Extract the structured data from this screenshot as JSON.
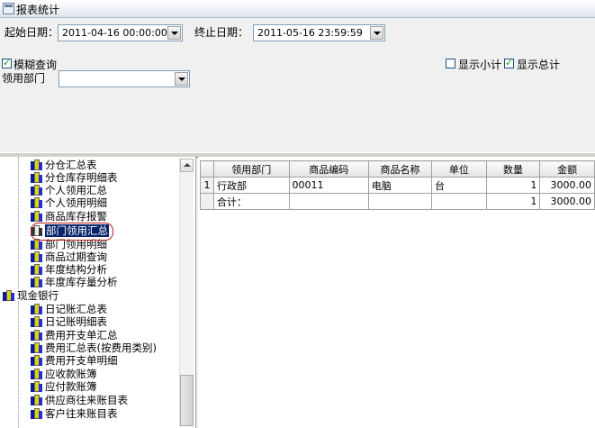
{
  "window": {
    "title": "报表统计"
  },
  "filters": {
    "start_label": "起始日期：",
    "start_value": "2011-04-16 00:00:00",
    "end_label": "终止日期：",
    "end_value": "2011-05-16 23:59:59",
    "fuzzy_label": "模糊查询",
    "fuzzy_checked": true,
    "dept_label": "领用部门",
    "dept_value": "",
    "show_subtotal_label": "显示小计",
    "show_subtotal_checked": false,
    "show_total_label": "显示总计",
    "show_total_checked": true
  },
  "tree": {
    "group1_items": [
      "分仓汇总表",
      "分仓库存明细表",
      "个人领用汇总",
      "个人领用明细",
      "商品库存报警",
      "部门领用汇总",
      "部门领用明细",
      "商品过期查询",
      "年度结构分析",
      "年度库存量分析"
    ],
    "selected_item": "部门领用汇总",
    "group2_label": "现金银行",
    "group2_items": [
      "日记账汇总表",
      "日记账明细表",
      "费用开支单汇总",
      "费用汇总表(按费用类别)",
      "费用开支单明细",
      "应收款账簿",
      "应付款账簿",
      "供应商往来账目表",
      "客户往来账目表"
    ]
  },
  "grid": {
    "columns": [
      "领用部门",
      "商品编码",
      "商品名称",
      "单位",
      "数量",
      "金额"
    ],
    "rows": [
      {
        "index": "1",
        "dept": "行政部",
        "code": "00011",
        "name": "电脑",
        "unit": "台",
        "qty": "1",
        "amount": "3000.00"
      }
    ],
    "total_row": {
      "label": "合计：",
      "qty": "1",
      "amount": "3000.00"
    }
  }
}
